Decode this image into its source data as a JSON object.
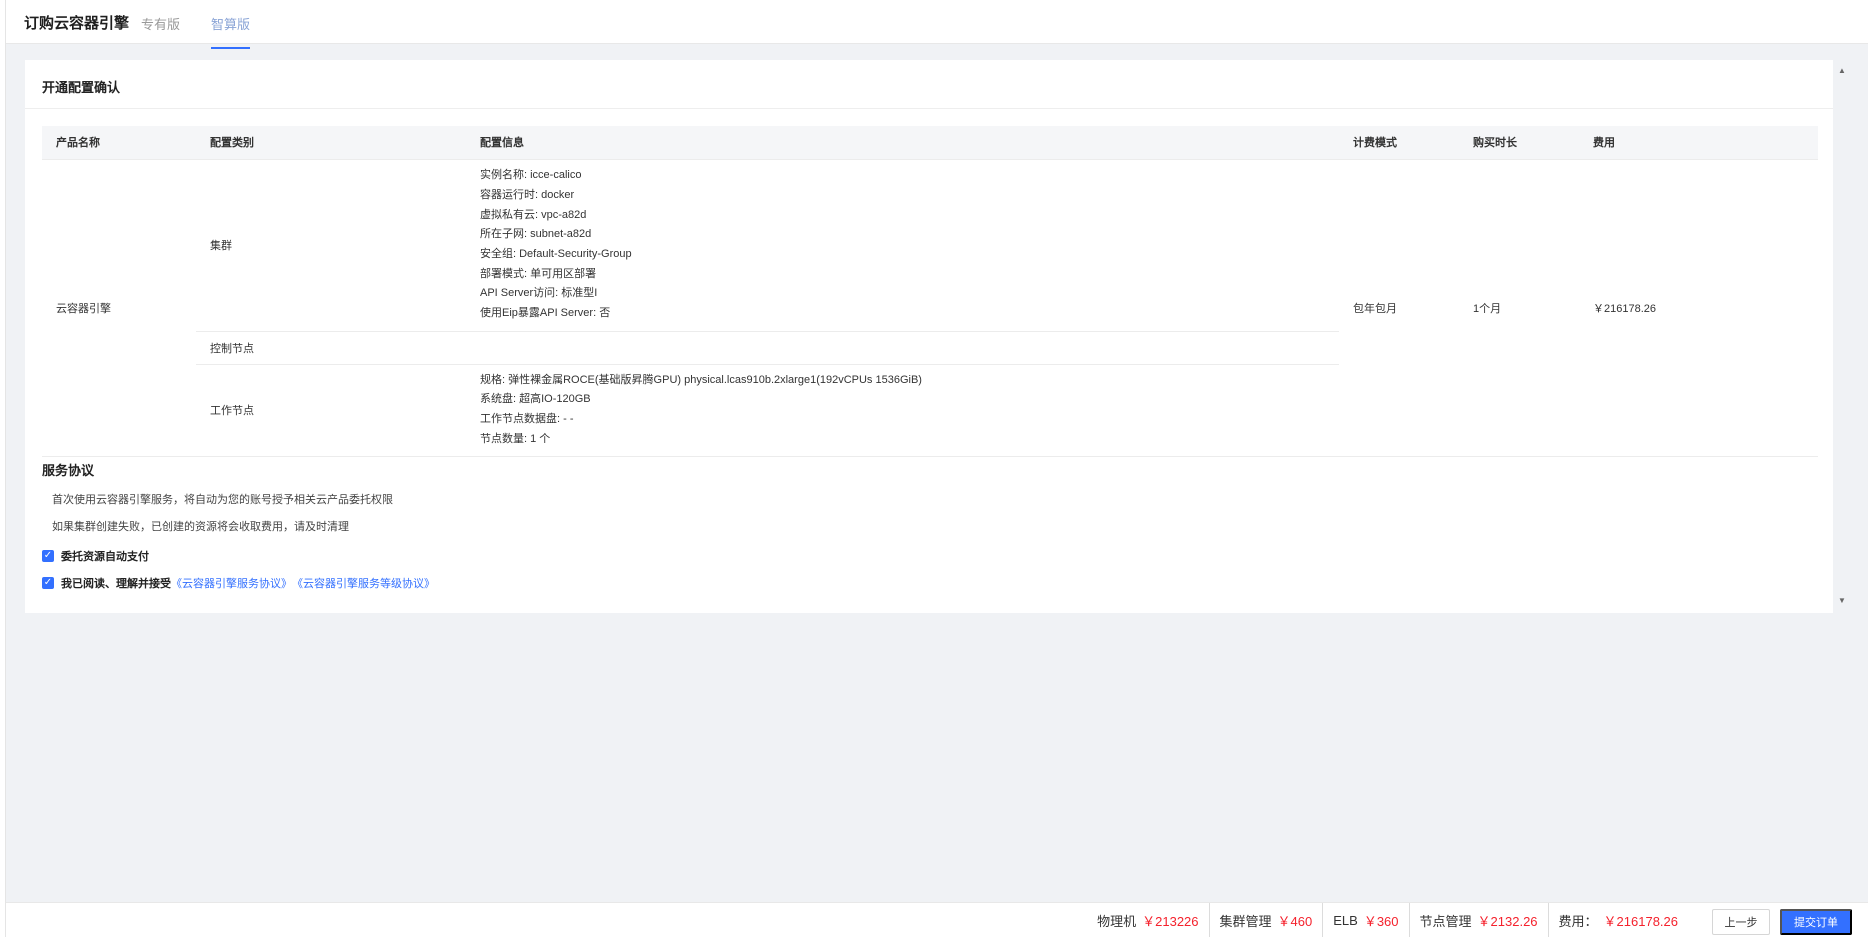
{
  "header": {
    "title": "订购云容器引擎",
    "tabs": [
      {
        "label": "专有版"
      },
      {
        "label": "智算版"
      }
    ]
  },
  "card": {
    "title": "开通配置确认"
  },
  "table": {
    "columns": [
      "产品名称",
      "配置类别",
      "配置信息",
      "计费模式",
      "购买时长",
      "费用"
    ],
    "product_name": "云容器引擎",
    "billing_mode": "包年包月",
    "duration": "1个月",
    "fee": "￥216178.26",
    "groups": [
      {
        "category": "集群",
        "info": [
          "实例名称: icce-calico",
          "容器运行时: docker",
          "虚拟私有云: vpc-a82d",
          "所在子网: subnet-a82d",
          "安全组: Default-Security-Group",
          "部署模式: 单可用区部署",
          "API Server访问: 标准型I",
          "使用Eip暴露API Server: 否"
        ]
      },
      {
        "category": "控制节点",
        "info": []
      },
      {
        "category": "工作节点",
        "info": [
          "规格: 弹性裸金属ROCE(基础版昇腾GPU) physical.lcas910b.2xlarge1(192vCPUs 1536GiB)",
          "系统盘: 超高IO-120GB",
          "工作节点数据盘: - -",
          "节点数量: 1 个"
        ]
      }
    ]
  },
  "agreement": {
    "title": "服务协议",
    "line1": "首次使用云容器引擎服务，将自动为您的账号授予相关云产品委托权限",
    "line2": "如果集群创建失败，已创建的资源将会收取费用，请及时清理",
    "check1": "委托资源自动支付",
    "check2_prefix": "我已阅读、理解并接受",
    "link1": "《云容器引擎服务协议》",
    "link2": "《云容器引擎服务等级协议》"
  },
  "footer": {
    "items": [
      {
        "label": "物理机",
        "value": "￥213226"
      },
      {
        "label": "集群管理",
        "value": "￥460"
      },
      {
        "label": "ELB",
        "value": "￥360"
      },
      {
        "label": "节点管理",
        "value": "￥2132.26"
      },
      {
        "label": "费用：",
        "value": "￥216178.26"
      }
    ],
    "prev_label": "上一步",
    "submit_label": "提交订单"
  },
  "colors": {
    "accent": "#3370ff",
    "price": "#f5222d"
  }
}
